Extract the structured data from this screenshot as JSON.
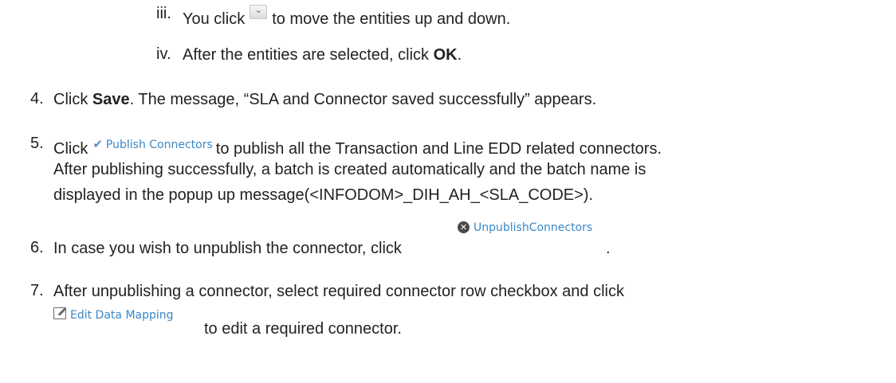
{
  "steps": {
    "iii": {
      "number": "iii.",
      "before": "You click",
      "button_icon": "chevron-down-icon",
      "after": "to move the entities up and down."
    },
    "iv": {
      "number": "iv.",
      "before": "After the entities are selected, click",
      "bold": "OK",
      "after": "."
    },
    "s4": {
      "number": "4.",
      "before": "Click",
      "bold": "Save",
      "after": ". The message, “SLA and Connector saved successfully” appears."
    },
    "s5": {
      "number": "5.",
      "before": "Click",
      "button_label": "Publish Connectors",
      "button_icon": "check-icon",
      "after": "to publish all the Transaction and Line EDD related connectors.",
      "line2": "After publishing successfully, a batch is created automatically and the batch name is",
      "line3": "displayed in the popup up message(<INFODOM>_DIH_AH_<SLA_CODE>)."
    },
    "s6": {
      "number": "6.",
      "text": "In case you wish to unpublish the connector, click",
      "button_label": "UnpublishConnectors",
      "button_icon": "circle-x-icon",
      "after": "."
    },
    "s7": {
      "number": "7.",
      "line1": "After unpublishing a connector, select required connector row checkbox and click",
      "button_label": "Edit Data Mapping",
      "button_icon": "edit-icon",
      "after": "to edit a required connector."
    }
  },
  "colors": {
    "link_blue": "#3a87c6",
    "text": "#222222"
  }
}
